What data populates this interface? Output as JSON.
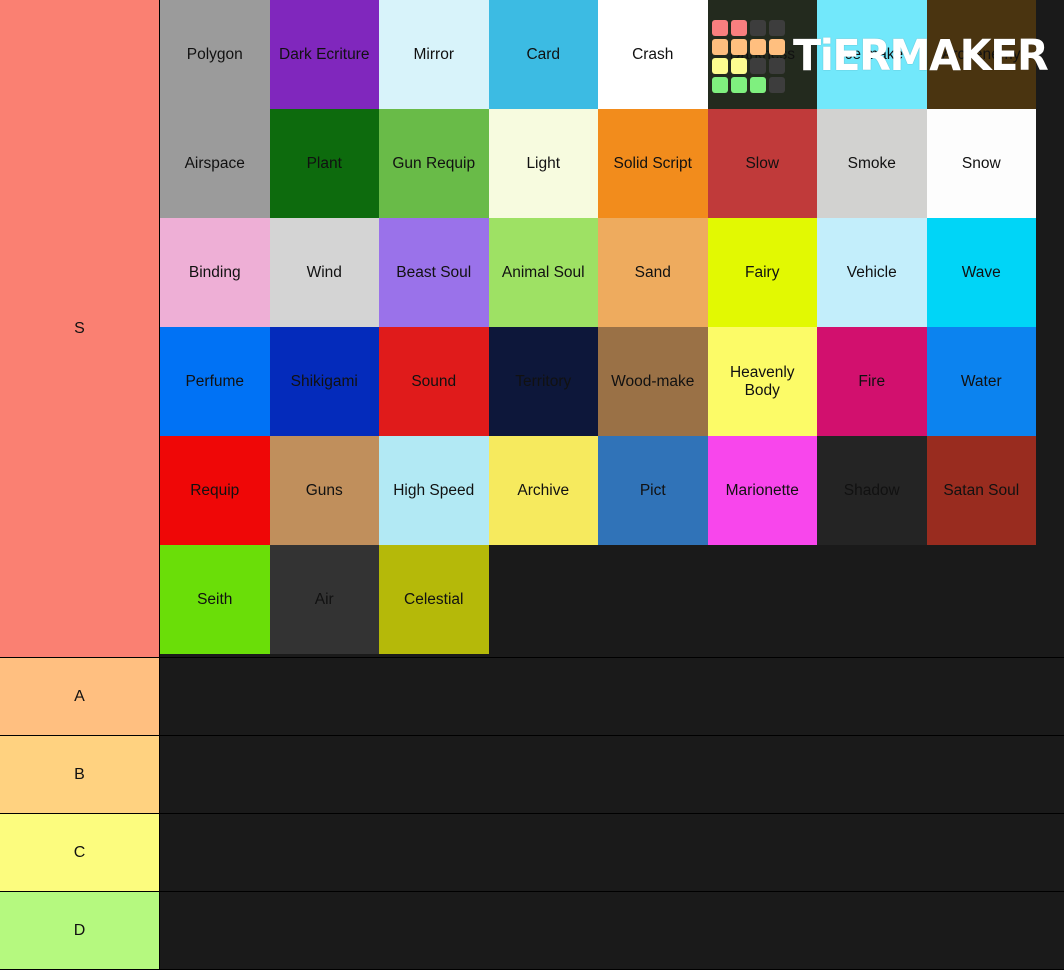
{
  "app": {
    "name": "TierMaker",
    "watermark_text": "TiERMAKER",
    "background_color": "#1a1a1a"
  },
  "watermark_logo": {
    "name": "tiermaker-logo-grid",
    "rows": [
      [
        "r",
        "r",
        "d",
        "d"
      ],
      [
        "o",
        "o",
        "o",
        "o"
      ],
      [
        "y",
        "y",
        "d",
        "d"
      ],
      [
        "g",
        "g",
        "g",
        "d"
      ]
    ],
    "colors": {
      "r": "#fa7f7f",
      "o": "#ffbf7f",
      "y": "#fdfd90",
      "g": "#7ff07f",
      "d": "#3d3d3d"
    }
  },
  "tiers": [
    {
      "label": "S",
      "color": "#fa8072",
      "items": [
        {
          "label": "Polygon",
          "color": "#9b9b9b",
          "text_color": "#111111"
        },
        {
          "label": "Dark Ecriture",
          "color": "#8027bd",
          "text_color": "#111111"
        },
        {
          "label": "Mirror",
          "color": "#d8f3fa",
          "text_color": "#111111"
        },
        {
          "label": "Card",
          "color": "#3cbbe3",
          "text_color": "#111111"
        },
        {
          "label": "Crash",
          "color": "#ffffff",
          "text_color": "#111111"
        },
        {
          "label": "Darkness",
          "color": "#232a1e",
          "text_color": "#111111"
        },
        {
          "label": "Ice make",
          "color": "#72e8fb",
          "text_color": "#111111"
        },
        {
          "label": "Archenemy",
          "color": "#4a3410",
          "text_color": "#111111"
        },
        {
          "label": "Airspace",
          "color": "#9b9b9b",
          "text_color": "#111111"
        },
        {
          "label": "Plant",
          "color": "#0d6b0d",
          "text_color": "#111111"
        },
        {
          "label": "Gun Requip",
          "color": "#69bb48",
          "text_color": "#111111"
        },
        {
          "label": "Light",
          "color": "#f7fbdf",
          "text_color": "#111111"
        },
        {
          "label": "Solid Script",
          "color": "#f28c1c",
          "text_color": "#111111"
        },
        {
          "label": "Slow",
          "color": "#c03a3a",
          "text_color": "#111111"
        },
        {
          "label": "Smoke",
          "color": "#d2d2d0",
          "text_color": "#111111"
        },
        {
          "label": "Snow",
          "color": "#fdfdfd",
          "text_color": "#111111"
        },
        {
          "label": "Binding",
          "color": "#eeafd6",
          "text_color": "#111111"
        },
        {
          "label": "Wind",
          "color": "#d4d4d4",
          "text_color": "#111111"
        },
        {
          "label": "Beast Soul",
          "color": "#9a72ea",
          "text_color": "#111111"
        },
        {
          "label": "Animal Soul",
          "color": "#9ee164",
          "text_color": "#111111"
        },
        {
          "label": "Sand",
          "color": "#eeab5e",
          "text_color": "#111111"
        },
        {
          "label": "Fairy",
          "color": "#e2f902",
          "text_color": "#111111"
        },
        {
          "label": "Vehicle",
          "color": "#c3eefb",
          "text_color": "#111111"
        },
        {
          "label": "Wave",
          "color": "#00d5f7",
          "text_color": "#111111"
        },
        {
          "label": "Perfume",
          "color": "#0072f5",
          "text_color": "#111111"
        },
        {
          "label": "Shikigami",
          "color": "#042bbb",
          "text_color": "#111111"
        },
        {
          "label": "Sound",
          "color": "#e01b1b",
          "text_color": "#111111"
        },
        {
          "label": "Territory",
          "color": "#0d173a",
          "text_color": "#111111"
        },
        {
          "label": "Wood-make",
          "color": "#9a7146",
          "text_color": "#111111"
        },
        {
          "label": "Heavenly Body",
          "color": "#fcfb67",
          "text_color": "#111111"
        },
        {
          "label": "Fire",
          "color": "#d2106e",
          "text_color": "#111111"
        },
        {
          "label": "Water",
          "color": "#0c83ef",
          "text_color": "#111111"
        },
        {
          "label": "Requip",
          "color": "#ef0707",
          "text_color": "#111111"
        },
        {
          "label": "Guns",
          "color": "#c08f5c",
          "text_color": "#111111"
        },
        {
          "label": "High Speed",
          "color": "#b2e9f4",
          "text_color": "#111111"
        },
        {
          "label": "Archive",
          "color": "#f6ea5e",
          "text_color": "#111111"
        },
        {
          "label": "Pict",
          "color": "#3073b8",
          "text_color": "#111111"
        },
        {
          "label": "Marionette",
          "color": "#f846ec",
          "text_color": "#111111"
        },
        {
          "label": "Shadow",
          "color": "#242424",
          "text_color": "#111111"
        },
        {
          "label": "Satan Soul",
          "color": "#992c1f",
          "text_color": "#111111"
        },
        {
          "label": "Seith",
          "color": "#6ade08",
          "text_color": "#111111"
        },
        {
          "label": "Air",
          "color": "#333333",
          "text_color": "#111111"
        },
        {
          "label": "Celestial",
          "color": "#b5b909",
          "text_color": "#111111"
        }
      ]
    },
    {
      "label": "A",
      "color": "#ffbf80",
      "items": []
    },
    {
      "label": "B",
      "color": "#ffd280",
      "items": []
    },
    {
      "label": "C",
      "color": "#fcfc7e",
      "items": []
    },
    {
      "label": "D",
      "color": "#b5f97f",
      "items": []
    }
  ]
}
